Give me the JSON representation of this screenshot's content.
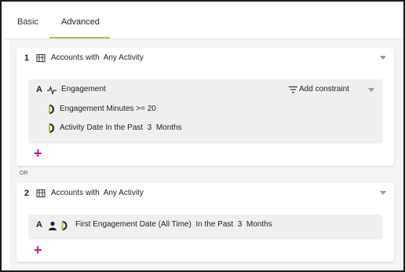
{
  "tabs": {
    "basic": "Basic",
    "advanced": "Advanced",
    "active": "Advanced"
  },
  "accent_color": "#a8c64a",
  "add_color": "#c2188a",
  "blocks": [
    {
      "number": "1",
      "icon": "building-icon",
      "title": "Accounts with  Any Activity",
      "group": {
        "letter": "A",
        "icon": "activity-icon",
        "label": "Engagement",
        "add_constraint": "Add constraint",
        "conditions": [
          "Engagement Minutes >= 20",
          "Activity Date In the Past  3  Months"
        ]
      },
      "add": "+"
    },
    {
      "number": "2",
      "icon": "building-icon",
      "title": "Accounts with  Any Activity",
      "group": {
        "letter": "A",
        "condition": "First Engagement Date (All Time)  In the Past  3  Months"
      },
      "add": "+"
    }
  ],
  "or_label": "OR"
}
